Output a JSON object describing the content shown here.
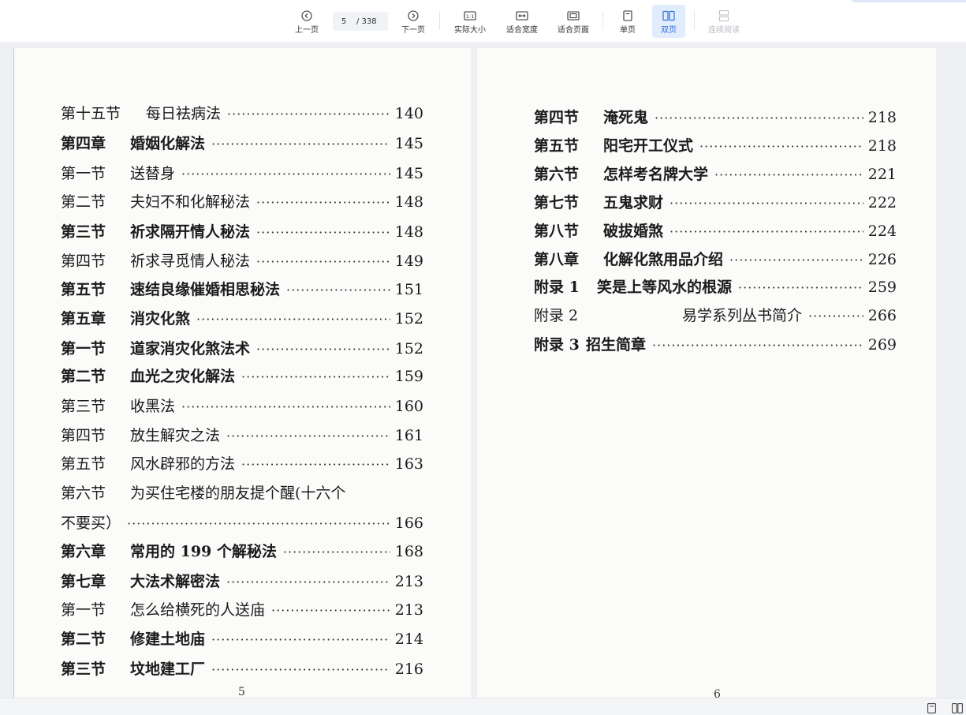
{
  "toolbar": {
    "prev_label": "上一页",
    "next_label": "下一页",
    "current_page": "5",
    "total_pages": "/ 338",
    "actual_size_label": "实际大小",
    "fit_width_label": "适合宽度",
    "fit_page_label": "适合页面",
    "single_page_label": "单页",
    "double_page_label": "双页",
    "continuous_label": "连续阅读",
    "actual_size_glyph": "1:1",
    "active_mode": "double",
    "accent_color": "#2f6fe0"
  },
  "left_page": {
    "page_number": "5",
    "rows": [
      {
        "sec": "第十五节",
        "title": "每日袪病法",
        "page": "140"
      },
      {
        "sec": "第四章",
        "title": "婚姻化解法",
        "page": "145"
      },
      {
        "sec": "第一节",
        "title": "送替身",
        "page": "145"
      },
      {
        "sec": "第二节",
        "title": "夫妇不和化解秘法",
        "page": "148"
      },
      {
        "sec": "第三节",
        "title": "祈求隔开情人秘法",
        "page": "148"
      },
      {
        "sec": "第四节",
        "title": "祈求寻觅情人秘法",
        "page": "149"
      },
      {
        "sec": "第五节",
        "title": "速结良缘催婚相思秘法",
        "page": "151"
      },
      {
        "sec": "第五章",
        "title": "消灾化煞",
        "page": "152"
      },
      {
        "sec": "第一节",
        "title": "道家消灾化煞法术",
        "page": "152"
      },
      {
        "sec": "第二节",
        "title": "血光之灾化解法",
        "page": "159"
      },
      {
        "sec": "第三节",
        "title": "收黑法",
        "page": "160"
      },
      {
        "sec": "第四节",
        "title": "放生解灾之法",
        "page": "161"
      },
      {
        "sec": "第五节",
        "title": "风水辟邪的方法",
        "page": "163"
      },
      {
        "sec": "第六节",
        "title": "为买住宅楼的朋友提个醒(十六个",
        "page": ""
      },
      {
        "sec": "",
        "title": "不要买）",
        "page": "166"
      },
      {
        "sec": "第六章",
        "title": "常用的 199 个解秘法",
        "page": "168"
      },
      {
        "sec": "第七章",
        "title": "大法术解密法",
        "page": "213"
      },
      {
        "sec": "第一节",
        "title": "怎么给横死的人送庙",
        "page": "213"
      },
      {
        "sec": "第二节",
        "title": "修建土地庙",
        "page": "214"
      },
      {
        "sec": "第三节",
        "title": "坟地建工厂",
        "page": "216"
      }
    ]
  },
  "right_page": {
    "page_number": "6",
    "rows": [
      {
        "sec": "第四节",
        "title": "淹死鬼",
        "page": "218"
      },
      {
        "sec": "第五节",
        "title": "阳宅开工仪式",
        "page": "218"
      },
      {
        "sec": "第六节",
        "title": "怎样考名牌大学",
        "page": "221"
      },
      {
        "sec": "第七节",
        "title": "五鬼求财",
        "page": "222"
      },
      {
        "sec": "第八节",
        "title": "破拔婚煞",
        "page": "224"
      },
      {
        "sec": "第八章",
        "title": "化解化煞用品介绍",
        "page": "226"
      },
      {
        "sec": "附录 1",
        "title": "笑是上等风水的根源",
        "page": "259"
      },
      {
        "sec": "附录 2",
        "title": "易学系列丛书简介",
        "page": "266"
      },
      {
        "sec": "附录 3",
        "title": "招生简章",
        "page": "269"
      }
    ]
  }
}
